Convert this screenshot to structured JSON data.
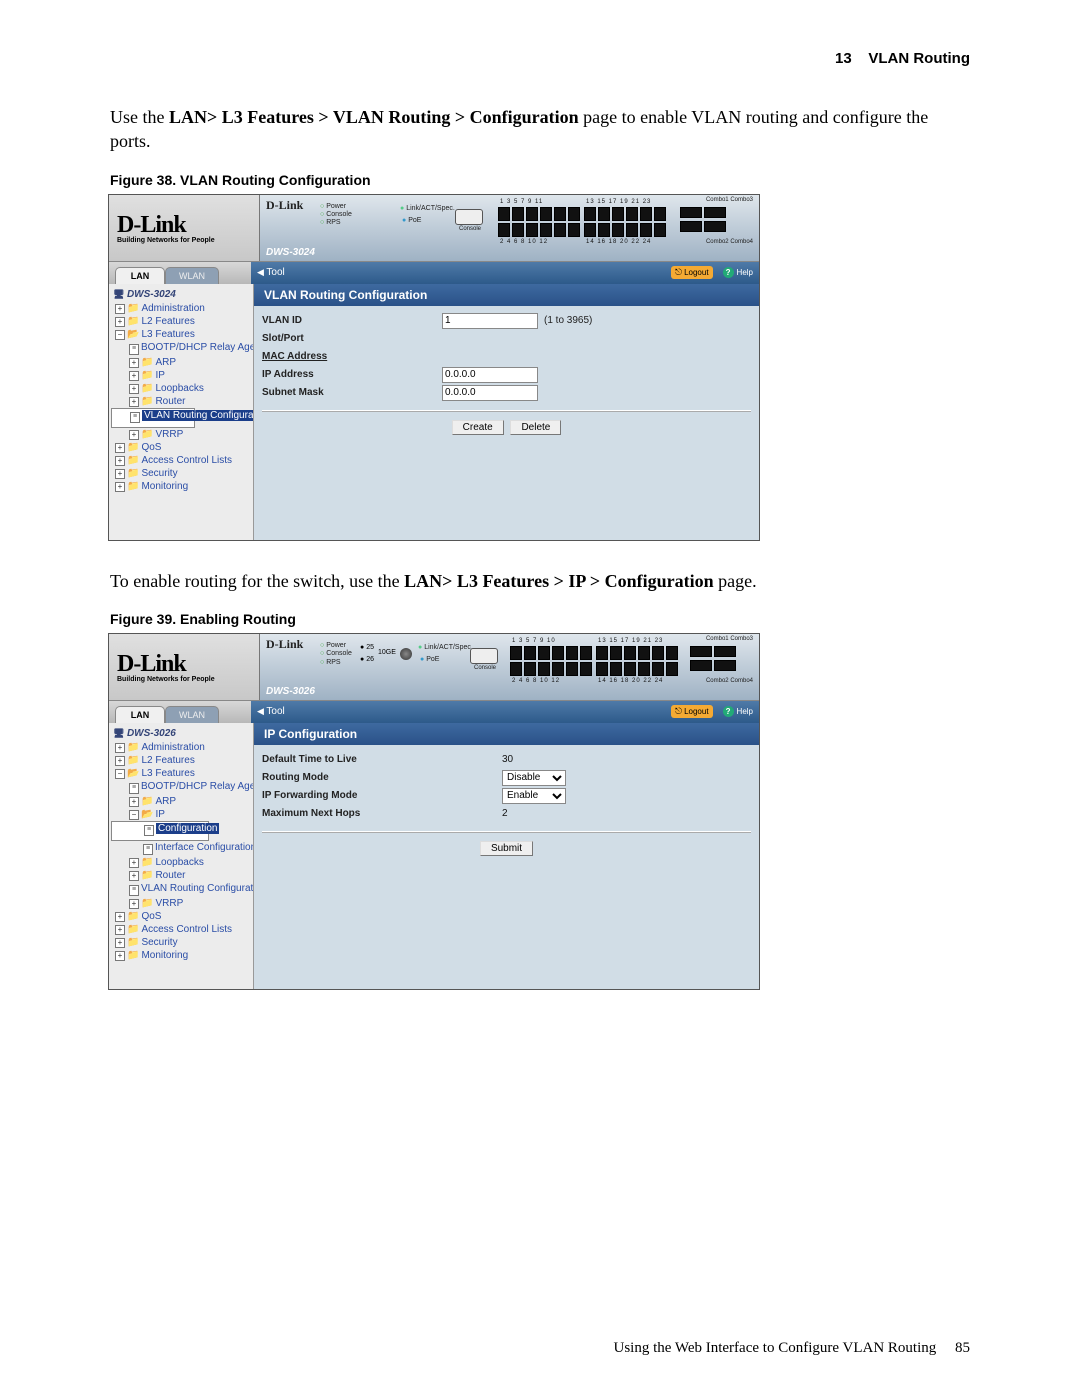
{
  "header": {
    "chapter_num": "13",
    "chapter_title": "VLAN Routing"
  },
  "para1": {
    "pre": "Use the ",
    "bold": "LAN> L3 Features > VLAN Routing > Configuration",
    "post": " page to enable VLAN routing and configure the ports."
  },
  "fig38": {
    "caption_label": "Figure 38.",
    "caption_text": "VLAN Routing Configuration",
    "brand": "D-Link",
    "brand_sub": "Building Networks for People",
    "model": "DWS-3024",
    "leds": {
      "power": "Power",
      "console": "Console",
      "rps": "RPS"
    },
    "linkact": "Link/ACT/Spec.",
    "poe": "PoE",
    "console_label": "Console",
    "odd_ports": "1  3  5  7  9  11",
    "odd_ports2": "13 15 17 19 21 23",
    "even_ports": "2  4  6  8  10 12",
    "even_ports2": "14 16 18 20 22 24",
    "combo1": "Combo1 Combo3",
    "combo2": "Combo2 Combo4",
    "tabs": {
      "lan": "LAN",
      "wlan": "WLAN"
    },
    "toolbar": {
      "tool": "Tool",
      "logout": "Logout",
      "help": "Help"
    },
    "nav": {
      "device": "DWS-3024",
      "admin": "Administration",
      "l2": "L2 Features",
      "l3": "L3 Features",
      "bootp": "BOOTP/DHCP Relay Agen",
      "arp": "ARP",
      "ip": "IP",
      "loop": "Loopbacks",
      "router": "Router",
      "vlanrc": "VLAN Routing Configurati",
      "vrrp": "VRRP",
      "qos": "QoS",
      "acl": "Access Control Lists",
      "sec": "Security",
      "mon": "Monitoring"
    },
    "content": {
      "title": "VLAN Routing Configuration",
      "rows": {
        "vlan_id": {
          "k": "VLAN ID",
          "val": "1",
          "hint": "(1 to 3965)"
        },
        "slot_port": {
          "k": "Slot/Port",
          "val": ""
        },
        "mac": {
          "k": "MAC Address",
          "val": ""
        },
        "ip": {
          "k": "IP Address",
          "val": "0.0.0.0"
        },
        "subnet": {
          "k": "Subnet Mask",
          "val": "0.0.0.0"
        }
      },
      "create": "Create",
      "delete": "Delete"
    }
  },
  "para2": {
    "pre": "To enable routing for the switch, use the ",
    "bold": "LAN> L3 Features > IP > Configuration",
    "post": " page."
  },
  "fig39": {
    "caption_label": "Figure 39.",
    "caption_text": "Enabling Routing",
    "brand": "D-Link",
    "brand_sub": "Building Networks for People",
    "model": "DWS-3026",
    "leds": {
      "power": "Power",
      "console": "Console",
      "rps": "RPS",
      "n25": "25",
      "n26": "26"
    },
    "tenge": "10GE",
    "linkact": "Link/ACT/Spec.",
    "poe": "PoE",
    "console_label": "Console",
    "odd_ports": "1  3  5  7  9  10",
    "odd_ports2": "13 15 17 19 21 23",
    "even_ports": "2  4  6  8  10 12",
    "even_ports2": "14 16 18 20 22 24",
    "combo1": "Combo1 Combo3",
    "combo2": "Combo2 Combo4",
    "tabs": {
      "lan": "LAN",
      "wlan": "WLAN"
    },
    "toolbar": {
      "tool": "Tool",
      "logout": "Logout",
      "help": "Help"
    },
    "nav": {
      "device": "DWS-3026",
      "admin": "Administration",
      "l2": "L2 Features",
      "l3": "L3 Features",
      "bootp": "BOOTP/DHCP Relay Agen",
      "arp": "ARP",
      "ip": "IP",
      "ip_conf": "Configuration",
      "ip_ifconf": "Interface Configuration",
      "loop": "Loopbacks",
      "router": "Router",
      "vlanrc": "VLAN Routing Configurati",
      "vrrp": "VRRP",
      "qos": "QoS",
      "acl": "Access Control Lists",
      "sec": "Security",
      "mon": "Monitoring"
    },
    "content": {
      "title": "IP Configuration",
      "rows": {
        "ttl": {
          "k": "Default Time to Live",
          "val": "30"
        },
        "rm": {
          "k": "Routing Mode",
          "val": "Disable"
        },
        "fwd": {
          "k": "IP Forwarding Mode",
          "val": "Enable"
        },
        "hops": {
          "k": "Maximum Next Hops",
          "val": "2"
        }
      },
      "submit": "Submit"
    }
  },
  "footer": {
    "text": "Using the Web Interface to Configure VLAN Routing",
    "page": "85"
  }
}
